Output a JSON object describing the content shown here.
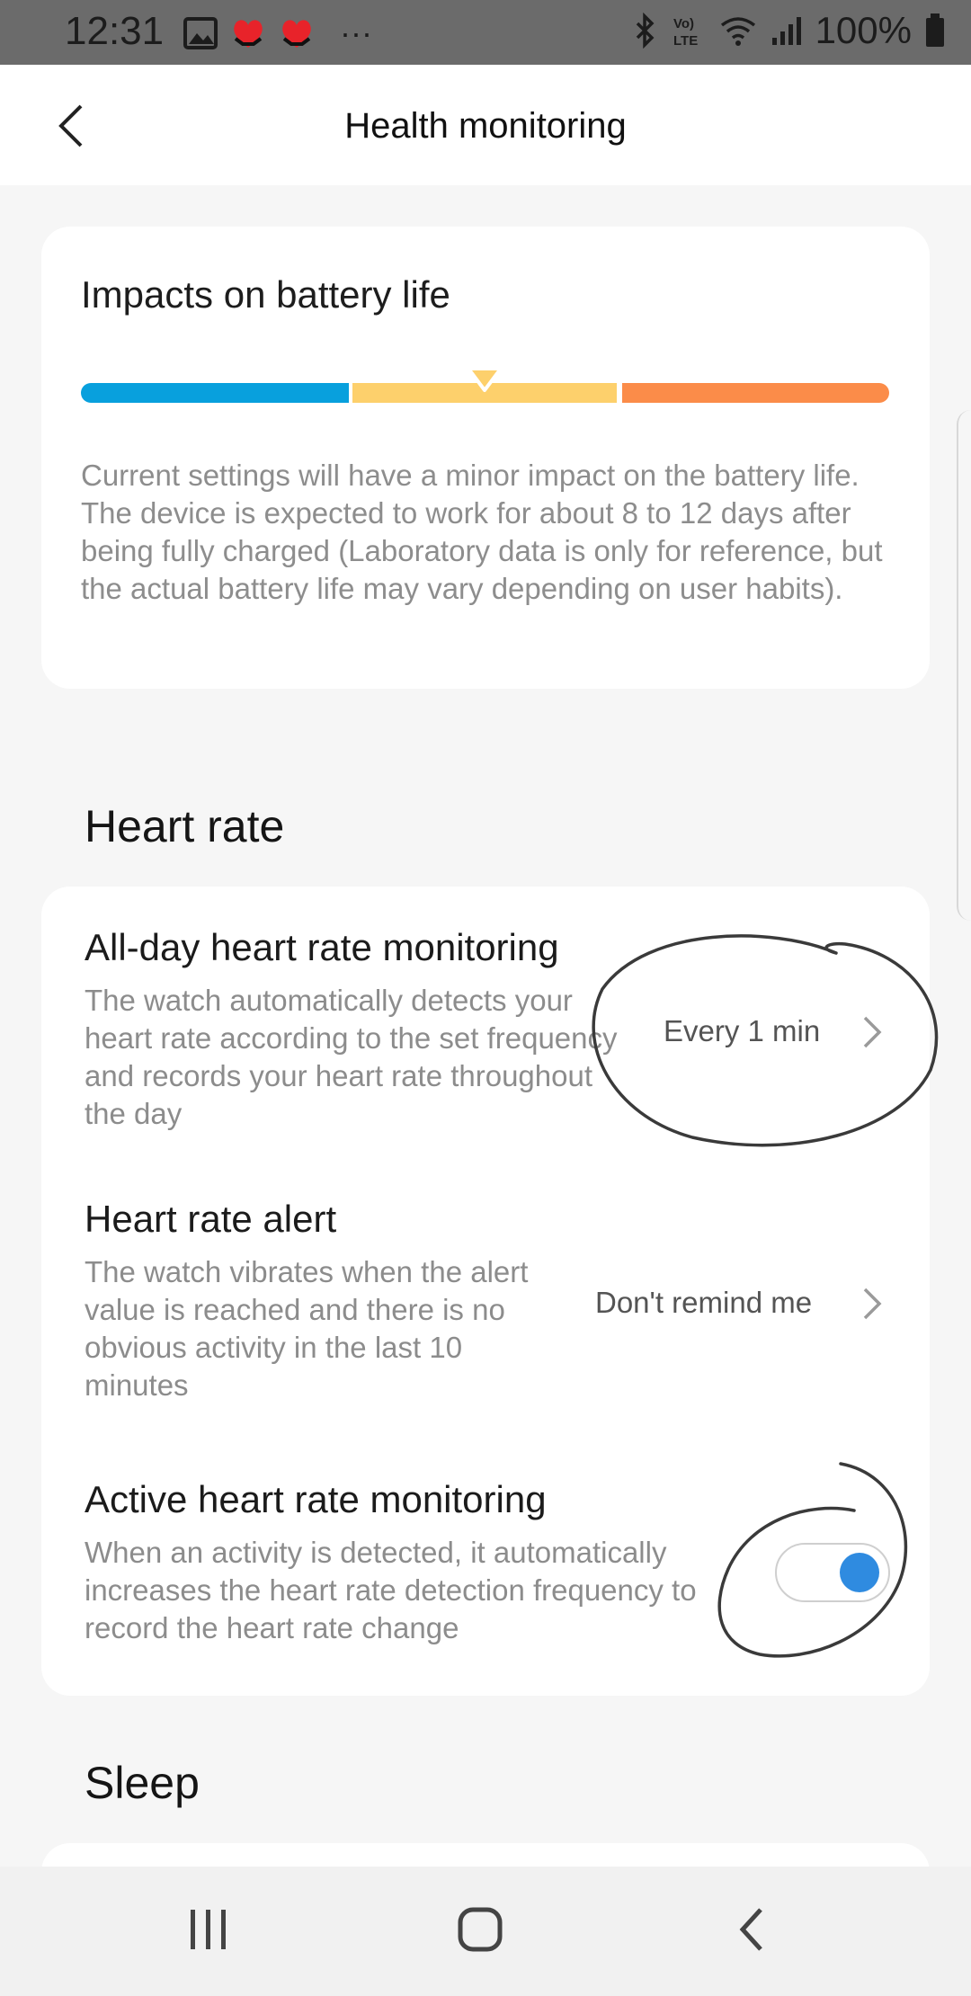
{
  "status_bar": {
    "time": "12:31",
    "battery": "100%",
    "more": "···",
    "lte_label": "LTE",
    "icons": [
      "gallery-icon",
      "heart-notification-icon",
      "heart-notification-icon",
      "bluetooth-icon",
      "volte-icon",
      "wifi-icon",
      "signal-icon",
      "battery-icon"
    ]
  },
  "header": {
    "title": "Health monitoring"
  },
  "battery_card": {
    "title": "Impacts on battery life",
    "level": "medium",
    "segments": [
      {
        "name": "low",
        "color": "#08a0dd"
      },
      {
        "name": "medium",
        "color": "#fdd06c"
      },
      {
        "name": "high",
        "color": "#fb8c49"
      }
    ],
    "description": "Current settings will have a minor impact on the battery life. The device is expected to work for about 8 to 12 days after being fully charged (Laboratory data is only for reference, but the actual battery life may vary depending on user habits)."
  },
  "heart_rate": {
    "section_title": "Heart rate",
    "items": [
      {
        "title": "All-day heart rate monitoring",
        "description": "The watch automatically detects your heart rate according to the set frequency and records your heart rate throughout the day",
        "value": "Every 1 min"
      },
      {
        "title": "Heart rate alert",
        "description": "The watch vibrates when the alert value is reached and there is no obvious activity in the last 10 minutes",
        "value": "Don't remind me"
      },
      {
        "title": "Active heart rate monitoring",
        "description": "When an activity is detected, it automatically increases the heart rate detection frequency to record the heart rate change",
        "toggle_on": true
      }
    ]
  },
  "sleep": {
    "section_title": "Sleep"
  },
  "colors": {
    "accent": "#2f8be0",
    "page_bg": "#f6f6f6",
    "card_bg": "#ffffff"
  }
}
